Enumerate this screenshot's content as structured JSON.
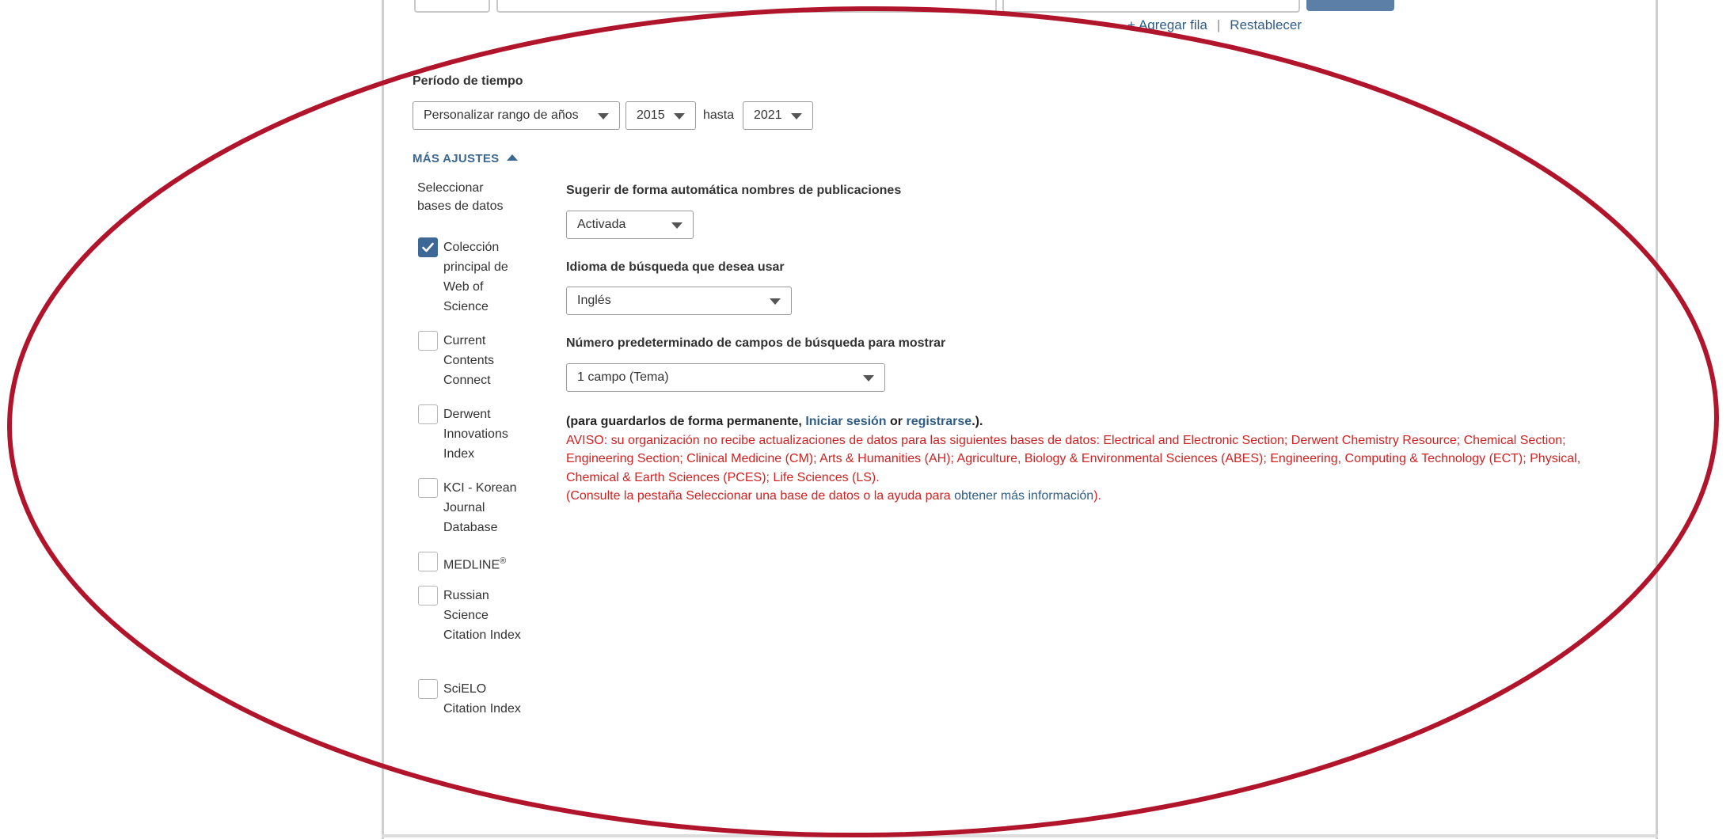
{
  "top_links": {
    "add_row": "Agregar fila",
    "separator": "|",
    "reset": "Restablecer",
    "plus": "+"
  },
  "time_period": {
    "label": "Período de tiempo",
    "range_select": "Personalizar rango de años",
    "from_year": "2015",
    "to_word": "hasta",
    "to_year": "2021"
  },
  "more_settings": {
    "label": "MÁS AJUSTES"
  },
  "databases": {
    "heading": "Seleccionar bases de datos",
    "items": [
      {
        "label": "Colección principal de Web of Science",
        "checked": true
      },
      {
        "label": "Current Contents Connect",
        "checked": false
      },
      {
        "label": "Derwent Innovations Index",
        "checked": false
      },
      {
        "label": "KCI - Korean Journal Database",
        "checked": false
      },
      {
        "label": "MEDLINE",
        "sup": "®",
        "checked": false
      },
      {
        "label": "Russian Science Citation Index",
        "checked": false
      },
      {
        "label": "SciELO Citation Index",
        "checked": false
      }
    ]
  },
  "settings": {
    "autosuggest": {
      "label": "Sugerir de forma automática nombres de publicaciones",
      "value": "Activada"
    },
    "language": {
      "label": "Idioma de búsqueda que desea usar",
      "value": "Inglés"
    },
    "fields": {
      "label": "Número predeterminado de campos de búsqueda para mostrar",
      "value": "1 campo (Tema)"
    }
  },
  "notice": {
    "save_prefix": "(para guardarlos de forma permanente, ",
    "sign_in": "Iniciar sesión",
    "or_word": " or ",
    "register": "registrarse",
    "save_suffix": ".).",
    "warning": "AVISO: su organización no recibe actualizaciones de datos para las siguientes bases de datos: Electrical and Electronic Section; Derwent Chemistry Resource; Chemical Section; Engineering Section; Clinical Medicine (CM); Arts & Humanities (AH); Agriculture, Biology & Environmental Sciences (ABES); Engineering, Computing & Technology (ECT); Physical, Chemical & Earth Sciences (PCES); Life Sciences (LS).",
    "consult_prefix": "(Consulte la pestaña Seleccionar una base de datos o la ayuda para ",
    "more_info": "obtener más información",
    "consult_suffix": ")."
  },
  "colors": {
    "accent": "#3d6794",
    "link": "#2f5d85",
    "warning": "#d32020",
    "annotation": "#b0152b"
  }
}
